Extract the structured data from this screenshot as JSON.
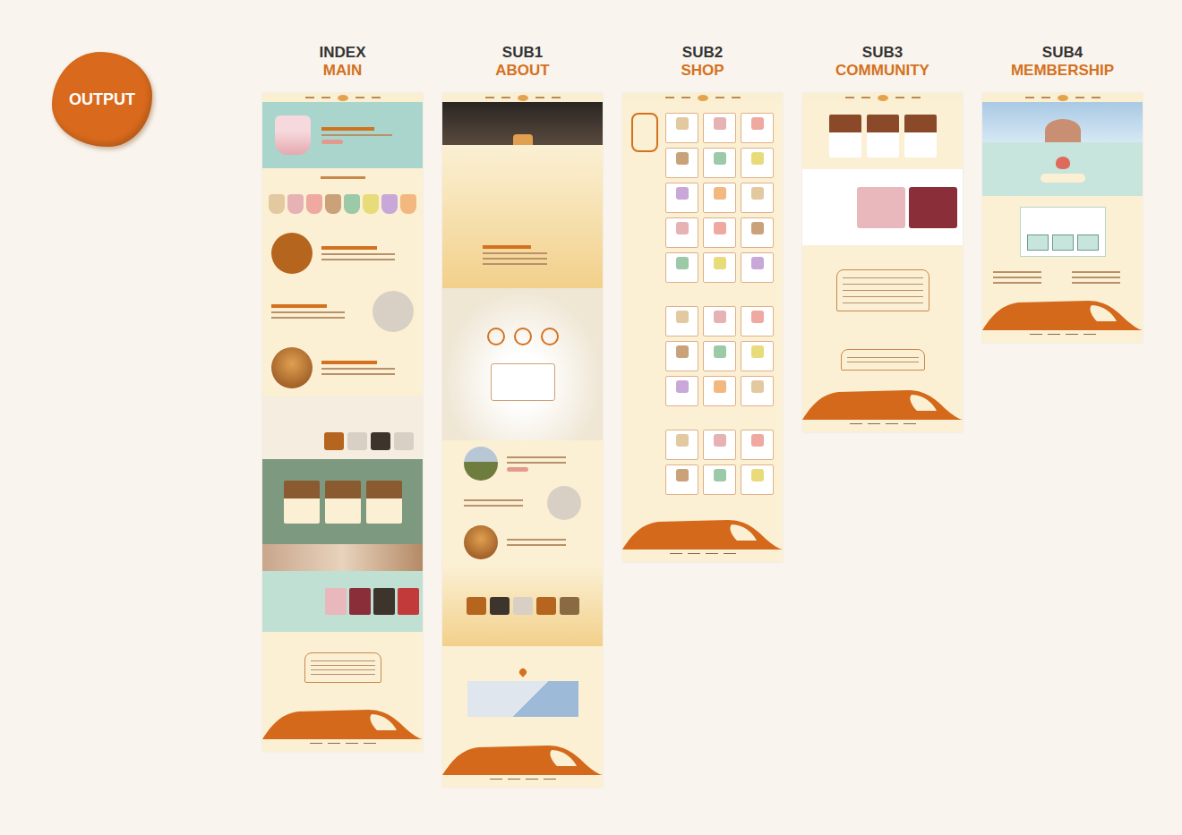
{
  "badge": "OUTPUT",
  "pages": [
    {
      "code": "INDEX",
      "name": "MAIN"
    },
    {
      "code": "SUB1",
      "name": "ABOUT"
    },
    {
      "code": "SUB2",
      "name": "SHOP"
    },
    {
      "code": "SUB3",
      "name": "COMMUNITY"
    },
    {
      "code": "SUB4",
      "name": "MEMBERSHIP"
    }
  ]
}
